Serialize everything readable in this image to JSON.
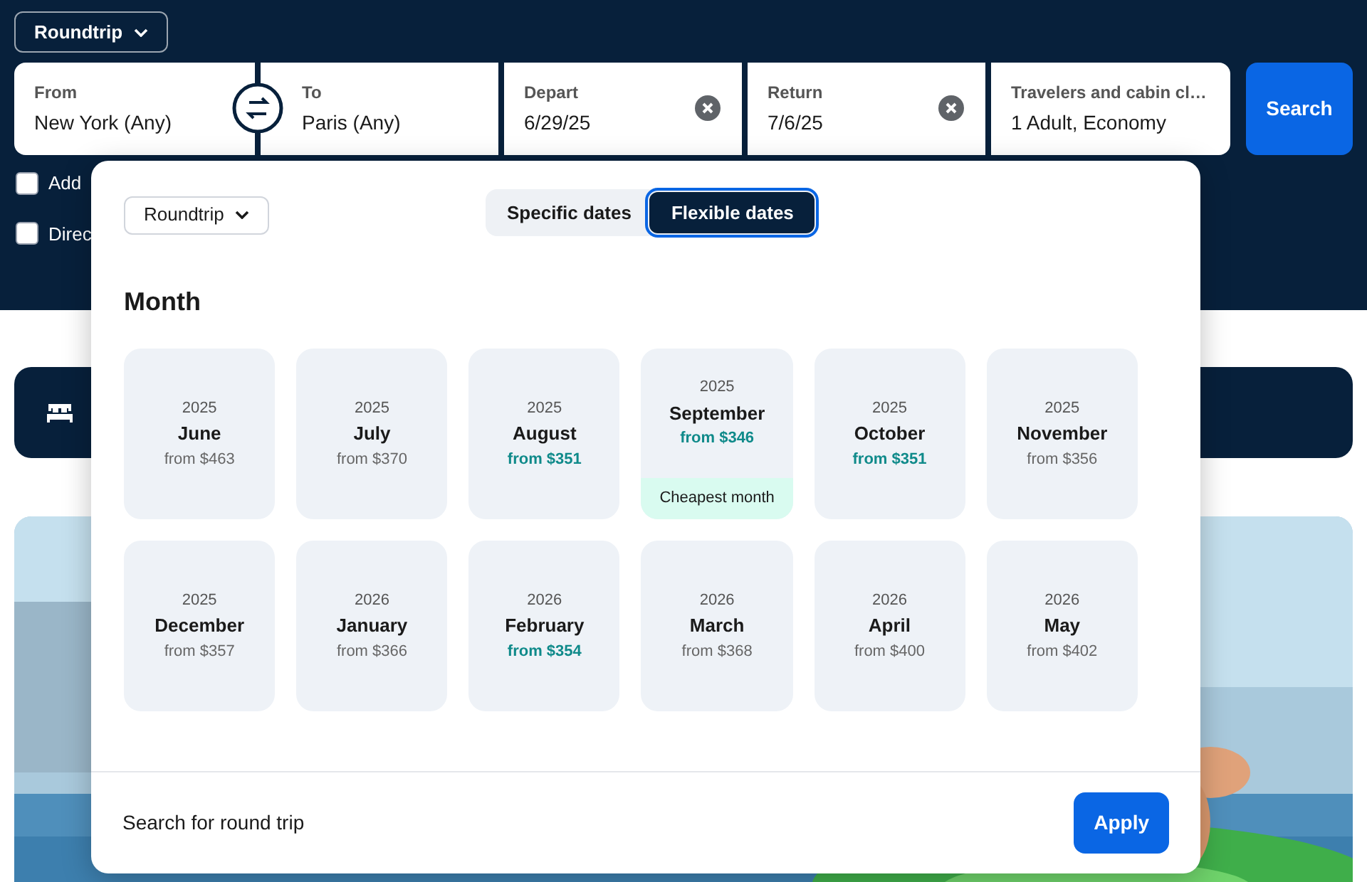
{
  "trip_type": "Roundtrip",
  "search_fields": [
    {
      "label": "From",
      "value": "New York (Any)",
      "kind": "from"
    },
    {
      "label": "To",
      "value": "Paris (Any)",
      "kind": "to"
    },
    {
      "label": "Depart",
      "value": "6/29/25",
      "kind": "date"
    },
    {
      "label": "Return",
      "value": "7/6/25",
      "kind": "date"
    },
    {
      "label": "Travelers and cabin cl…",
      "value": "1 Adult, Economy",
      "kind": "plain"
    }
  ],
  "search_button": "Search",
  "options": [
    {
      "label": "Add",
      "checked": false
    },
    {
      "label": "Direc",
      "checked": false
    }
  ],
  "popup": {
    "trip_type": "Roundtrip",
    "date_modes": [
      {
        "label": "Specific dates",
        "selected": false
      },
      {
        "label": "Flexible dates",
        "selected": true
      }
    ],
    "heading": "Month",
    "months": [
      {
        "year": "2025",
        "month": "June",
        "price": "from $463",
        "deal": false
      },
      {
        "year": "2025",
        "month": "July",
        "price": "from $370",
        "deal": false
      },
      {
        "year": "2025",
        "month": "August",
        "price": "from $351",
        "deal": true
      },
      {
        "year": "2025",
        "month": "September",
        "price": "from $346",
        "deal": true,
        "badge": "Cheapest month"
      },
      {
        "year": "2025",
        "month": "October",
        "price": "from $351",
        "deal": true
      },
      {
        "year": "2025",
        "month": "November",
        "price": "from $356",
        "deal": false
      },
      {
        "year": "2025",
        "month": "December",
        "price": "from $357",
        "deal": false
      },
      {
        "year": "2026",
        "month": "January",
        "price": "from $366",
        "deal": false
      },
      {
        "year": "2026",
        "month": "February",
        "price": "from $354",
        "deal": true
      },
      {
        "year": "2026",
        "month": "March",
        "price": "from $368",
        "deal": false
      },
      {
        "year": "2026",
        "month": "April",
        "price": "from $400",
        "deal": false
      },
      {
        "year": "2026",
        "month": "May",
        "price": "from $402",
        "deal": false
      }
    ],
    "footer_text": "Search for round trip",
    "apply_button": "Apply"
  }
}
